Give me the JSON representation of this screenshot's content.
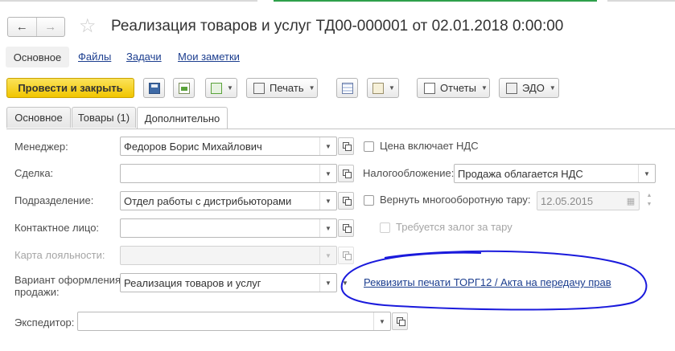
{
  "window": {
    "title": "Реализация товаров и услуг ТД00-000001 от 02.01.2018 0:00:00"
  },
  "nav": {
    "back_icon": "arrow-left-icon",
    "forward_icon": "arrow-right-icon",
    "favorite_icon": "star-icon"
  },
  "section_links": {
    "main": "Основное",
    "files": "Файлы",
    "tasks": "Задачи",
    "notes": "Мои заметки"
  },
  "toolbar": {
    "post_close": "Провести и закрыть",
    "print": "Печать",
    "reports": "Отчеты",
    "edo": "ЭДО",
    "accent_color": "#f4c800"
  },
  "tabs": {
    "main": "Основное",
    "goods": "Товары (1)",
    "additional": "Дополнительно"
  },
  "form": {
    "manager_label": "Менеджер:",
    "manager_value": "Федоров Борис Михайлович",
    "deal_label": "Сделка:",
    "deal_value": "",
    "division_label": "Подразделение:",
    "division_value": "Отдел работы с дистрибьюторами",
    "contact_label": "Контактное лицо:",
    "contact_value": "",
    "loyalty_label": "Карта лояльности:",
    "loyalty_value": "",
    "sale_variant_label_1": "Вариант оформления",
    "sale_variant_label_2": "продажи:",
    "sale_variant_value": "Реализация товаров и услуг",
    "forwarder_label": "Экспедитор:",
    "forwarder_value": "",
    "vat_included": "Цена включает НДС",
    "taxation_label": "Налогообложение:",
    "taxation_value": "Продажа облагается НДС",
    "return_tare": "Вернуть многооборотную тару:",
    "return_tare_date": "12.05.2015",
    "deposit_required": "Требуется залог за тару",
    "print_details_link": "Реквизиты печати ТОРГ12 / Акта на передачу прав",
    "annotation_color": "#1a1adc"
  }
}
